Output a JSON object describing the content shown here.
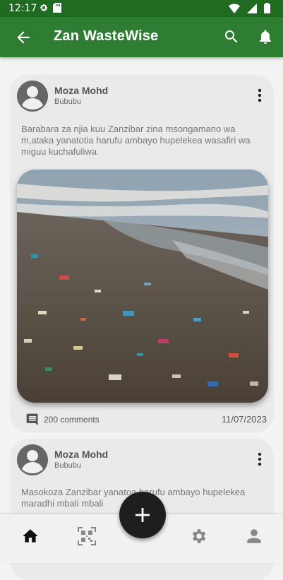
{
  "status_bar": {
    "time": "12:17"
  },
  "app_bar": {
    "title": "Zan WasteWise"
  },
  "posts": [
    {
      "author": "Moza Mohd",
      "location": "Bububu",
      "text": "Barabara za njia kuu Zanzibar zina msongamano wa m,ataka yanatotia harufu ambayo hupelekea wasafiri wa miguu kuchafuliwa",
      "comments": "200 comments",
      "date": "11/07/2023"
    },
    {
      "author": "Moza Mohd",
      "location": "Bububu",
      "text": "Masokoza  Zanzibar yanatoa harufu ambayo hupelekea maradhi mbali mbali"
    }
  ],
  "colors": {
    "app_bar": "#2e7d32",
    "status_bar": "#1f6b22",
    "fab": "#1e1e1e"
  },
  "icons": {
    "back": "arrow-back-icon",
    "search": "search-icon",
    "notifications": "bell-icon",
    "more": "more-vertical-icon",
    "comments": "comment-icon",
    "nav": [
      "home-icon",
      "qr-scan-icon",
      "settings-icon",
      "person-icon"
    ],
    "fab": "plus-icon"
  }
}
